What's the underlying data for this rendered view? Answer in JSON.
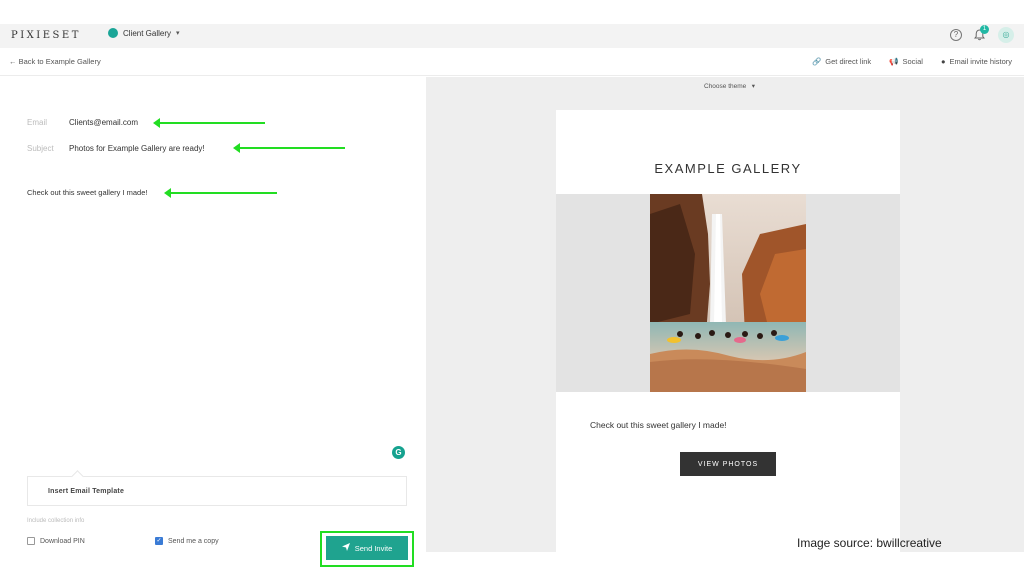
{
  "topbar": {
    "logo": "PIXIESET",
    "gallery_switcher": "Client Gallery",
    "notification_count": "1"
  },
  "subbar": {
    "back": "Back to Example Gallery",
    "actions": [
      {
        "label": "Get direct link",
        "icon": "link-icon"
      },
      {
        "label": "Social",
        "icon": "megaphone-icon"
      },
      {
        "label": "Email invite history",
        "icon": "history-icon"
      }
    ]
  },
  "form": {
    "email_label": "Email",
    "email_value": "Clients@email.com",
    "subject_label": "Subject",
    "subject_value": "Photos for Example Gallery are ready!",
    "body": "Check out this sweet gallery I made!",
    "template_button": "Insert Email Template",
    "collection_info": "Include collection info",
    "download_pin": "Download PIN",
    "download_pin_checked": false,
    "send_copy": "Send me a copy",
    "send_copy_checked": true,
    "send_button": "Send Invite"
  },
  "preview": {
    "theme_select": "Choose theme",
    "title": "EXAMPLE GALLERY",
    "body": "Check out this sweet gallery I made!",
    "button": "VIEW PHOTOS"
  },
  "caption": "Image source: bwillcreative",
  "colors": {
    "accent": "#1fa38f",
    "highlight": "#22dd22",
    "dark_button": "#333333"
  }
}
